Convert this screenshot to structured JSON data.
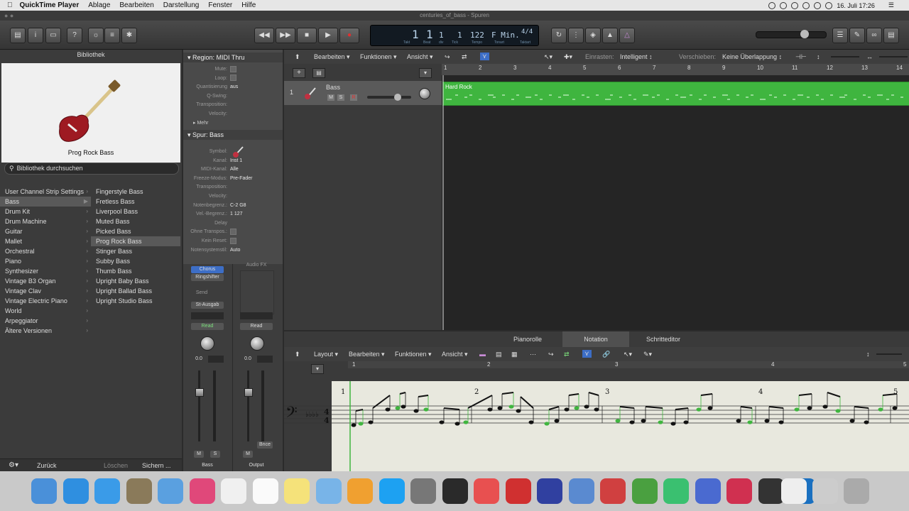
{
  "menubar": {
    "app": "QuickTime Player",
    "items": [
      "Ablage",
      "Bearbeiten",
      "Darstellung",
      "Fenster",
      "Hilfe"
    ],
    "datetime": "16. Juli  17:26"
  },
  "window": {
    "title": "centuries_of_bass - Spuren"
  },
  "lcd": {
    "bar": "1",
    "beat": "1",
    "div": "1",
    "tick": "1",
    "bar_label": "Takt",
    "beat_label": "Beat",
    "div_label": "div",
    "tick_label": "Tick",
    "tempo": "122",
    "tempo_label": "Tempo",
    "key": "F Min.",
    "key_label": "Tonart",
    "signature": "4/4",
    "signature_label": "Taktart"
  },
  "library": {
    "title": "Bibliothek",
    "preset_name": "Prog Rock Bass",
    "search_placeholder": "Bibliothek durchsuchen",
    "categories": [
      {
        "label": "User Channel Strip Settings"
      },
      {
        "label": "Bass",
        "selected": true
      },
      {
        "label": "Drum Kit"
      },
      {
        "label": "Drum Machine"
      },
      {
        "label": "Guitar"
      },
      {
        "label": "Mallet"
      },
      {
        "label": "Orchestral"
      },
      {
        "label": "Piano"
      },
      {
        "label": "Synthesizer"
      },
      {
        "label": "Vintage B3 Organ"
      },
      {
        "label": "Vintage Clav"
      },
      {
        "label": "Vintage Electric Piano"
      },
      {
        "label": "World"
      },
      {
        "label": "Arpeggiator"
      },
      {
        "label": "Ältere Versionen"
      }
    ],
    "presets": [
      {
        "label": "Fingerstyle Bass"
      },
      {
        "label": "Fretless Bass"
      },
      {
        "label": "Liverpool Bass"
      },
      {
        "label": "Muted Bass"
      },
      {
        "label": "Picked Bass"
      },
      {
        "label": "Prog Rock Bass",
        "selected": true
      },
      {
        "label": "Stinger Bass"
      },
      {
        "label": "Subby Bass"
      },
      {
        "label": "Thumb Bass"
      },
      {
        "label": "Upright Baby Bass"
      },
      {
        "label": "Upright Ballad Bass"
      },
      {
        "label": "Upright Studio Bass"
      }
    ],
    "back": "Zurück",
    "delete": "Löschen",
    "save": "Sichern ..."
  },
  "inspector": {
    "region_header": "Region:  MIDI Thru",
    "region_rows": [
      {
        "label": "Mute:",
        "value": "",
        "check": true
      },
      {
        "label": "Loop:",
        "value": "",
        "check": true
      },
      {
        "label": "Quantisierung",
        "value": "aus"
      },
      {
        "label": "Q-Swing:",
        "value": ""
      },
      {
        "label": "Transposition:",
        "value": ""
      },
      {
        "label": "Velocity:",
        "value": ""
      }
    ],
    "more": "Mehr",
    "track_header": "Spur: Bass",
    "track_rows": [
      {
        "label": "Symbol:",
        "value": ""
      },
      {
        "label": "Kanal:",
        "value": "Inst 1"
      },
      {
        "label": "MIDI-Kanal:",
        "value": "Alle"
      },
      {
        "label": "Freeze-Modus:",
        "value": "Pre-Fader"
      },
      {
        "label": "Transposition:",
        "value": ""
      },
      {
        "label": "Velocity:",
        "value": ""
      },
      {
        "label": "Notenbegrenz.:",
        "value": "C-2      G8"
      },
      {
        "label": "Vel.-Begrenz.:",
        "value": "1        127"
      },
      {
        "label": "Delay",
        "value": ""
      },
      {
        "label": "Ohne Transpos.:",
        "value": "",
        "check": true
      },
      {
        "label": "Kein Reset:",
        "value": "",
        "check": true
      },
      {
        "label": "Notensystemstil:",
        "value": "Auto"
      }
    ]
  },
  "strips": {
    "slot_chorus": "Chorus",
    "slot_ring": "Ringshifter",
    "audio_fx": "Audio FX",
    "send": "Send",
    "output": "St-Ausgab",
    "read1": "Read",
    "read2": "Read",
    "vol1": "0.0",
    "vol2": "0.0",
    "m": "M",
    "s": "S",
    "m2": "M",
    "bnce": "Bnce",
    "name1": "Bass",
    "name2": "Output"
  },
  "tracks_toolbar": {
    "edit": "Bearbeiten",
    "functions": "Funktionen",
    "view": "Ansicht",
    "snap_label": "Einrasten:",
    "snap_value": "Intelligent",
    "move_label": "Verschieben:",
    "move_value": "Keine Überlappung"
  },
  "track": {
    "number": "1",
    "name": "Bass",
    "m": "M",
    "s": "S",
    "r": "R"
  },
  "region": {
    "name": "Hard Rock"
  },
  "ruler_numbers": [
    "1",
    "2",
    "3",
    "4",
    "5",
    "6",
    "7",
    "8",
    "9",
    "10",
    "11",
    "12",
    "13",
    "14"
  ],
  "editor": {
    "tabs": [
      "Pianorolle",
      "Notation",
      "Schritteditor"
    ],
    "active_tab": "Notation",
    "toolbar": [
      "Layout",
      "Bearbeiten",
      "Funktionen",
      "Ansicht"
    ],
    "bar_numbers": [
      "1",
      "2",
      "3",
      "4",
      "5"
    ]
  },
  "colors": {
    "region": "#3fb53f",
    "accent_blue": "#3d6ec6",
    "record": "#e03030"
  }
}
